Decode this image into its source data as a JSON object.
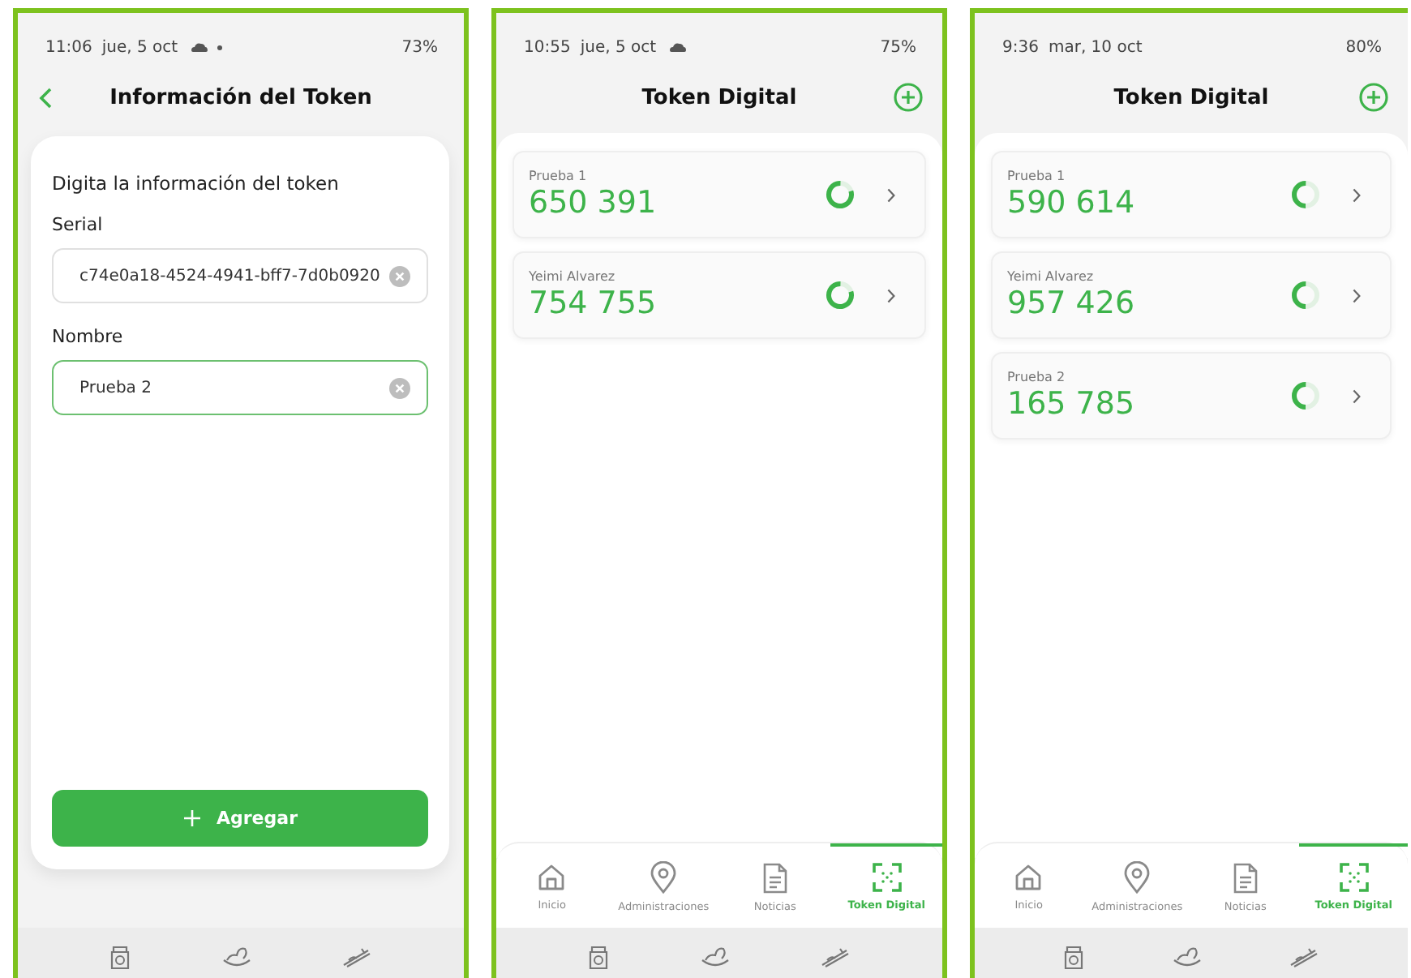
{
  "screens": [
    {
      "kind": "form",
      "status": {
        "time": "11:06",
        "date": "jue, 5 oct",
        "cloud": true,
        "notification_dot": true,
        "battery": "73%"
      },
      "header": {
        "title": "Información del Token",
        "back": true
      },
      "form": {
        "heading": "Digita la información del token",
        "fields": [
          {
            "label": "Serial",
            "value": "c74e0a18-4524-4941-bff7-7d0b0920",
            "focused": false
          },
          {
            "label": "Nombre",
            "value": "Prueba 2",
            "focused": true
          }
        ],
        "submit": "Agregar"
      }
    },
    {
      "kind": "list",
      "status": {
        "time": "10:55",
        "date": "jue, 5 oct",
        "cloud": true,
        "battery": "75%"
      },
      "header": {
        "title": "Token Digital",
        "add": true
      },
      "tokens": [
        {
          "name": "Prueba 1",
          "code": "650 391",
          "level": 0.8
        },
        {
          "name": "Yeimi Alvarez",
          "code": "754 755",
          "level": 0.8
        }
      ],
      "tabs": [
        {
          "label": "Inicio",
          "selected": false
        },
        {
          "label": "Administraciones",
          "selected": false
        },
        {
          "label": "Noticias",
          "selected": false
        },
        {
          "label": "Token Digital",
          "selected": true
        }
      ]
    },
    {
      "kind": "list",
      "status": {
        "time": "9:36",
        "date": "mar, 10 oct",
        "battery": "80%"
      },
      "header": {
        "title": "Token Digital",
        "add": true
      },
      "tokens": [
        {
          "name": "Prueba 1",
          "code": "590 614",
          "level": 0.5
        },
        {
          "name": "Yeimi Alvarez",
          "code": "957 426",
          "level": 0.5
        },
        {
          "name": "Prueba 2",
          "code": "165 785",
          "level": 0.5
        }
      ],
      "tabs": [
        {
          "label": "Inicio",
          "selected": false
        },
        {
          "label": "Administraciones",
          "selected": false
        },
        {
          "label": "Noticias",
          "selected": false
        },
        {
          "label": "Token Digital",
          "selected": true
        }
      ]
    }
  ]
}
